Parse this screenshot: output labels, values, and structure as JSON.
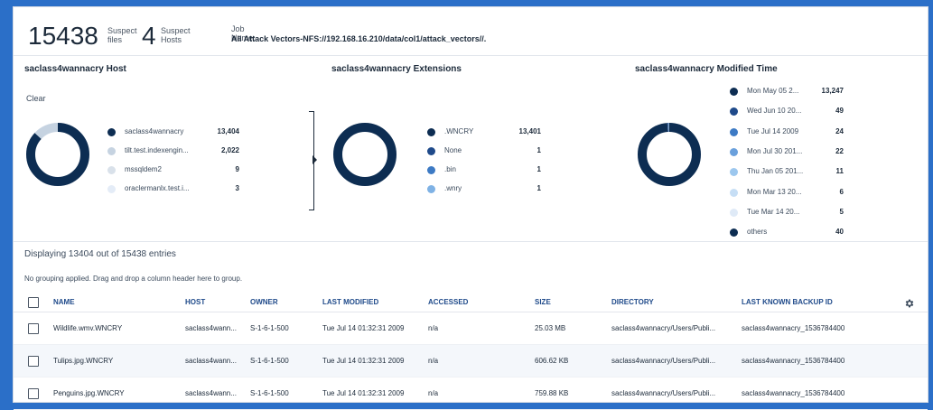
{
  "summary": {
    "suspect_files_count": "15438",
    "suspect_files_label_1": "Suspect",
    "suspect_files_label_2": "files",
    "suspect_hosts_count": "4",
    "suspect_hosts_label_1": "Suspect",
    "suspect_hosts_label_2": "Hosts",
    "job_name_label": "Job Name:",
    "job_name_value": "All Attack Vectors-NFS://192.168.16.210/data/col1/attack_vectors//."
  },
  "host_chart": {
    "title": "saclass4wannacry Host",
    "clear_label": "Clear",
    "items": [
      {
        "label": "saclass4wannacry",
        "count": "13,404",
        "value": 13404,
        "color": "#0d2d52"
      },
      {
        "label": "tilt.test.indexengin...",
        "count": "2,022",
        "value": 2022,
        "color": "#c6d3e1"
      },
      {
        "label": "mssqldem2",
        "count": "9",
        "value": 9,
        "color": "#d9e1ea"
      },
      {
        "label": "oraclermanlx.test.i...",
        "count": "3",
        "value": 3,
        "color": "#e4ecf7"
      }
    ]
  },
  "extensions_chart": {
    "title": "saclass4wannacry Extensions",
    "items": [
      {
        "label": ".WNCRY",
        "count": "13,401",
        "value": 13401,
        "color": "#0d2d52"
      },
      {
        "label": "None",
        "count": "1",
        "value": 1,
        "color": "#1f4a8a"
      },
      {
        "label": ".bin",
        "count": "1",
        "value": 1,
        "color": "#3d7ac4"
      },
      {
        "label": ".wnry",
        "count": "1",
        "value": 1,
        "color": "#7fb2e5"
      }
    ]
  },
  "modified_chart": {
    "title": "saclass4wannacry Modified Time",
    "items": [
      {
        "label": "Mon May 05 2...",
        "count": "13,247",
        "value": 13247,
        "color": "#0d2d52"
      },
      {
        "label": "Wed Jun 10 20...",
        "count": "49",
        "value": 49,
        "color": "#1f4a8a"
      },
      {
        "label": "Tue Jul 14 2009",
        "count": "24",
        "value": 24,
        "color": "#3d7ac4"
      },
      {
        "label": "Mon Jul 30 201...",
        "count": "22",
        "value": 22,
        "color": "#6aa0dc"
      },
      {
        "label": "Thu Jan 05 201...",
        "count": "11",
        "value": 11,
        "color": "#9cc7ee"
      },
      {
        "label": "Mon Mar 13 20...",
        "count": "6",
        "value": 6,
        "color": "#c6def5"
      },
      {
        "label": "Tue Mar 14 20...",
        "count": "5",
        "value": 5,
        "color": "#dfeaf7"
      },
      {
        "label": "others",
        "count": "40",
        "value": 40,
        "color": "#0d2d52"
      }
    ]
  },
  "grid": {
    "display_text": "Displaying 13404 out of 15438 entries",
    "grouping_text": "No grouping applied. Drag and drop a column header here to group.",
    "columns": [
      "NAME",
      "HOST",
      "OWNER",
      "LAST MODIFIED",
      "ACCESSED",
      "SIZE",
      "DIRECTORY",
      "LAST KNOWN BACKUP ID"
    ],
    "rows": [
      [
        "Wildlife.wmv.WNCRY",
        "saclass4wann...",
        "S-1-6-1-500",
        "Tue Jul 14 01:32:31 2009",
        "n/a",
        "25.03 MB",
        "saclass4wannacry/Users/Publi...",
        "saclass4wannacry_1536784400"
      ],
      [
        "Tulips.jpg.WNCRY",
        "saclass4wann...",
        "S-1-6-1-500",
        "Tue Jul 14 01:32:31 2009",
        "n/a",
        "606.62 KB",
        "saclass4wannacry/Users/Publi...",
        "saclass4wannacry_1536784400"
      ],
      [
        "Penguins.jpg.WNCRY",
        "saclass4wann...",
        "S-1-6-1-500",
        "Tue Jul 14 01:32:31 2009",
        "n/a",
        "759.88 KB",
        "saclass4wannacry/Users/Publi...",
        "saclass4wannacry_1536784400"
      ]
    ]
  }
}
